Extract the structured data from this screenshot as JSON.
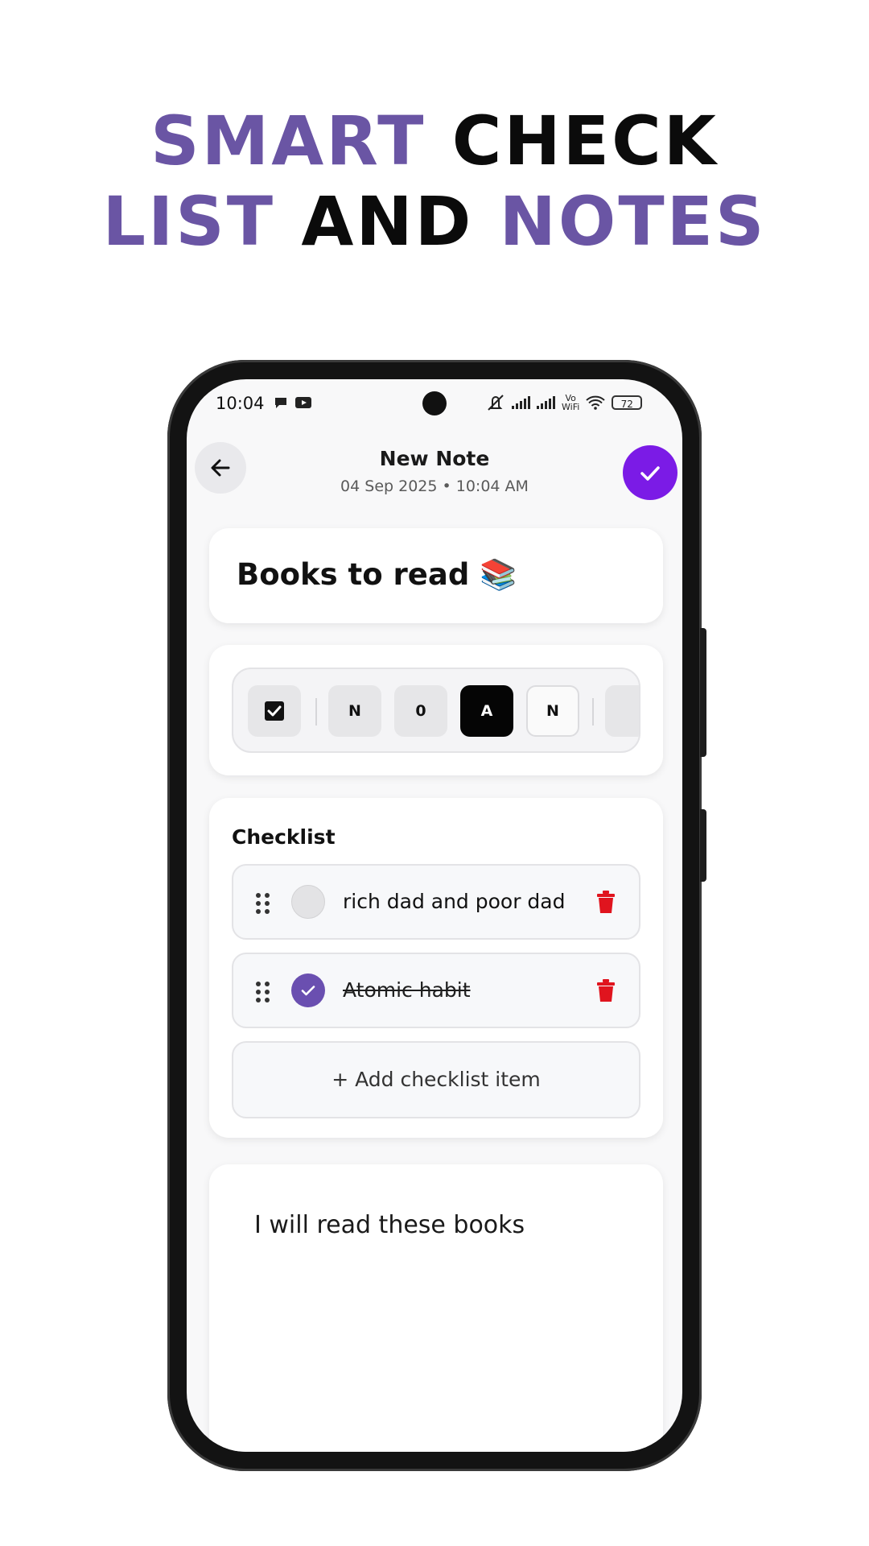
{
  "promo": {
    "line1_word1": "SMART",
    "line1_word2": "CHECK",
    "line2_word1": "LIST",
    "line2_word2": "AND",
    "line2_word3": "NOTES"
  },
  "colors": {
    "brand_purple": "#6a55a4",
    "save_button": "#7b1be6",
    "delete_red": "#e0141e",
    "check_purple": "#6a4fb0"
  },
  "status_bar": {
    "time": "10:04",
    "battery": "72",
    "vo_wifi_top": "Vo",
    "vo_wifi_bottom": "WiFi"
  },
  "header": {
    "title": "New Note",
    "subtitle": "04 Sep 2025 • 10:04 AM",
    "back_icon": "arrow-left-icon",
    "save_icon": "check-icon"
  },
  "note": {
    "title": "Books to read 📚",
    "body": "I will read these books"
  },
  "toolbar": {
    "buttons": [
      {
        "label": "",
        "icon": "checkbox-icon"
      },
      {
        "label": "N"
      },
      {
        "label": "0"
      },
      {
        "label": "A"
      },
      {
        "label": "N"
      }
    ]
  },
  "checklist": {
    "heading": "Checklist",
    "items": [
      {
        "text": "rich dad and poor dad",
        "checked": false
      },
      {
        "text": "Atomic habit",
        "checked": true
      }
    ],
    "add_label": "+ Add checklist item"
  }
}
